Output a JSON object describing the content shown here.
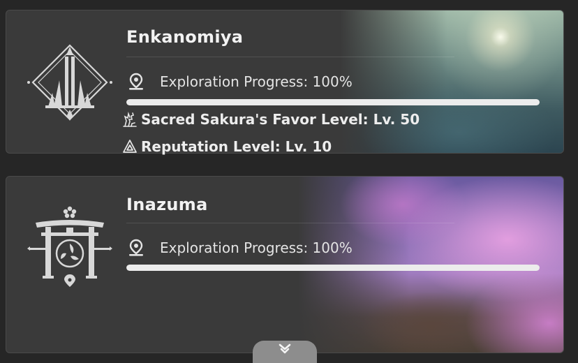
{
  "regions": [
    {
      "name": "Enkanomiya",
      "emblem_icon": "enkanomiya-emblem-icon",
      "progress_label": "Exploration Progress: 100%",
      "progress_value": 1.0,
      "stats": []
    },
    {
      "name": "Inazuma",
      "emblem_icon": "inazuma-emblem-icon",
      "progress_label": "Exploration Progress: 100%",
      "progress_value": 1.0,
      "stats": [
        {
          "icon": "sacred-sakura-icon",
          "label": "Sacred Sakura's Favor Level: Lv. 50"
        },
        {
          "icon": "reputation-icon",
          "label": "Reputation Level: Lv. 10"
        }
      ]
    }
  ],
  "expand_icon": "chevron-down-icon",
  "colors": {
    "background": "#262626",
    "card": "#3a3a3a",
    "progress_fill": "#ececec"
  }
}
